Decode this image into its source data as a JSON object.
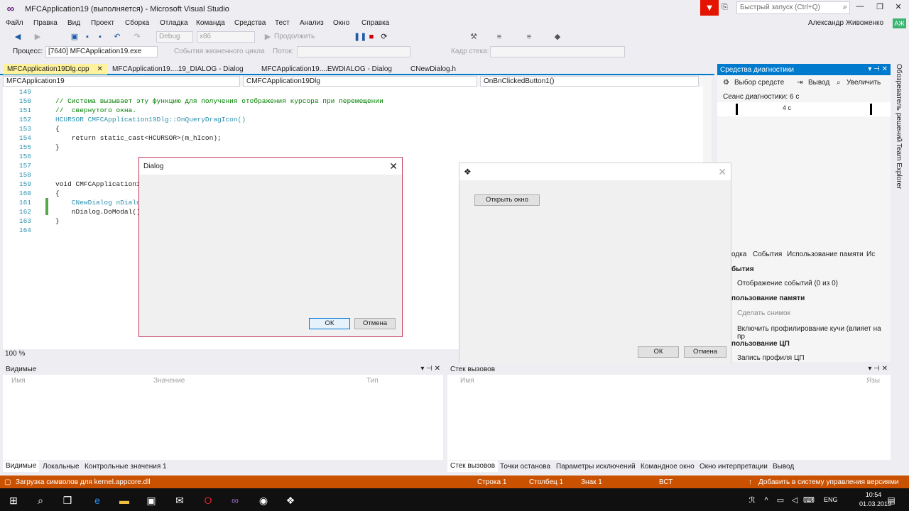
{
  "window": {
    "title": "MFCApplication19 (выполняется) - Microsoft Visual Studio",
    "quick_launch_placeholder": "Быстрый запуск (Ctrl+Q)",
    "user": "Александр Живоженко",
    "avatar": "АЖ"
  },
  "menu": [
    "Файл",
    "Правка",
    "Вид",
    "Проект",
    "Сборка",
    "Отладка",
    "Команда",
    "Средства",
    "Тест",
    "Анализ",
    "Окно",
    "Справка"
  ],
  "toolbar": {
    "config": "Debug",
    "platform": "x86",
    "continue": "Продолжить"
  },
  "toolbar2": {
    "process_label": "Процесс:",
    "process_value": "[7640] MFCApplication19.exe",
    "lifecycle": "События жизненного цикла",
    "thread_label": "Поток:",
    "stack_frame_label": "Кадр стека:"
  },
  "editor": {
    "tabs": [
      "MFCApplication19Dlg.cpp",
      "MFCApplication19....19_DIALOG - Dialog",
      "MFCApplication19....EWDIALOG - Dialog",
      "CNewDialog.h"
    ],
    "nav": [
      "MFCApplication19",
      "CMFCApplication19Dlg",
      "OnBnClickedButton1()"
    ],
    "zoom": "100 %",
    "lines": [
      {
        "n": "149",
        "t": ""
      },
      {
        "n": "150",
        "t": "// Система вызывает эту функцию для получения отображения курсора при перемещении"
      },
      {
        "n": "151",
        "t": "//  свернутого окна."
      },
      {
        "n": "152",
        "t": "HCURSOR CMFCApplication19Dlg::OnQueryDragIcon()"
      },
      {
        "n": "153",
        "t": "{"
      },
      {
        "n": "154",
        "t": "    return static_cast<HCURSOR>(m_hIcon);"
      },
      {
        "n": "155",
        "t": "}"
      },
      {
        "n": "156",
        "t": ""
      },
      {
        "n": "157",
        "t": ""
      },
      {
        "n": "158",
        "t": ""
      },
      {
        "n": "159",
        "t": "void CMFCApplication1"
      },
      {
        "n": "160",
        "t": "{"
      },
      {
        "n": "161",
        "t": "    CNewDialog nDialo"
      },
      {
        "n": "162",
        "t": "    nDialog.DoModal()"
      },
      {
        "n": "163",
        "t": "}"
      },
      {
        "n": "164",
        "t": ""
      }
    ]
  },
  "diagnostics": {
    "title": "Средства диагностики",
    "tool_select": "Выбор средсте",
    "output": "Вывод",
    "zoom": "Увеличить",
    "session": "Сеанс диагностики: 6 с",
    "timeline_label": "4 с",
    "tabs": [
      "одка",
      "События",
      "Использование памяти",
      "Ис"
    ],
    "section_events": "бытия",
    "events_item": "Отображение событий (0 из 0)",
    "section_memory": "пользование памяти",
    "snapshot": "Сделать снимок",
    "heap": "Включить профилирование кучи (влияет на пр",
    "section_cpu": "пользование ЦП",
    "cpu_item": "Запись профиля ЦП"
  },
  "side_tabs": [
    "Обозреватель решений",
    "Team Explorer"
  ],
  "dialog1": {
    "title": "Dialog",
    "ok": "ОК",
    "cancel": "Отмена"
  },
  "dialog2": {
    "open": "Открыть окно",
    "ok": "ОК",
    "cancel": "Отмена"
  },
  "locals": {
    "title": "Видимые",
    "cols": [
      "Имя",
      "Значение",
      "Тип"
    ]
  },
  "callstack": {
    "title": "Стек вызовов",
    "cols": [
      "Имя",
      "Язы"
    ]
  },
  "bottom_tabs_left": [
    "Видимые",
    "Локальные",
    "Контрольные значения 1"
  ],
  "bottom_tabs_right": [
    "Стек вызовов",
    "Точки останова",
    "Параметры исключений",
    "Командное окно",
    "Окно интерпретации",
    "Вывод"
  ],
  "status": {
    "message": "Загрузка символов для kernel.appcore.dll",
    "row": "Строка 1",
    "col": "Столбец 1",
    "char": "Знак 1",
    "ins": "ВСТ",
    "vcs": "Добавить в систему управления версиями"
  },
  "taskbar": {
    "lang": "ENG",
    "time": "10:54",
    "date": "01.03.2019"
  }
}
